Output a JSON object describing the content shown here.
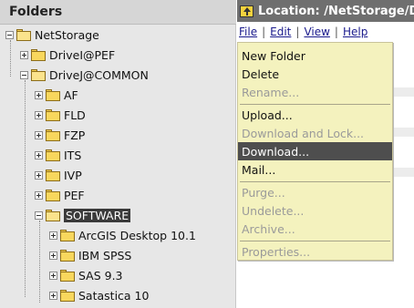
{
  "folders": {
    "title": "Folders",
    "tree": [
      {
        "label": "NetStorage",
        "expanded": true
      },
      {
        "label": "DriveI@PEF",
        "expanded": false
      },
      {
        "label": "DriveJ@COMMON",
        "expanded": true
      },
      {
        "label": "AF",
        "expanded": false
      },
      {
        "label": "FLD",
        "expanded": false
      },
      {
        "label": "FZP",
        "expanded": false
      },
      {
        "label": "ITS",
        "expanded": false
      },
      {
        "label": "IVP",
        "expanded": false
      },
      {
        "label": "PEF",
        "expanded": false
      },
      {
        "label": "SOFTWARE",
        "expanded": true,
        "selected": true
      },
      {
        "label": "ArcGIS Desktop 10.1",
        "expanded": false
      },
      {
        "label": "IBM SPSS",
        "expanded": false
      },
      {
        "label": "SAS 9.3",
        "expanded": false
      },
      {
        "label": "Satastica 10",
        "expanded": false
      }
    ]
  },
  "location": {
    "text": "Location: /NetStorage/DriveJ@COMMON/SOFTWARE",
    "up_icon": "folder-up-icon"
  },
  "menubar": {
    "file": "File",
    "edit": "Edit",
    "view": "View",
    "help": "Help",
    "separator": "|"
  },
  "file_menu": {
    "items": [
      {
        "label": "New Folder",
        "enabled": true
      },
      {
        "label": "Delete",
        "enabled": true
      },
      {
        "label": "Rename...",
        "enabled": false
      },
      {
        "label": "Upload...",
        "enabled": true
      },
      {
        "label": "Download and Lock...",
        "enabled": false
      },
      {
        "label": "Download...",
        "enabled": true,
        "highlighted": true
      },
      {
        "label": "Mail...",
        "enabled": true
      },
      {
        "label": "Purge...",
        "enabled": false
      },
      {
        "label": "Undelete...",
        "enabled": false
      },
      {
        "label": "Archive...",
        "enabled": false
      },
      {
        "label": "Properties...",
        "enabled": false
      }
    ]
  },
  "colors": {
    "menu_background": "#f4f2be",
    "menu_highlight": "#4e4e4e",
    "location_bar": "#6f6f6f",
    "folder_yellow": "#f8d75d"
  }
}
